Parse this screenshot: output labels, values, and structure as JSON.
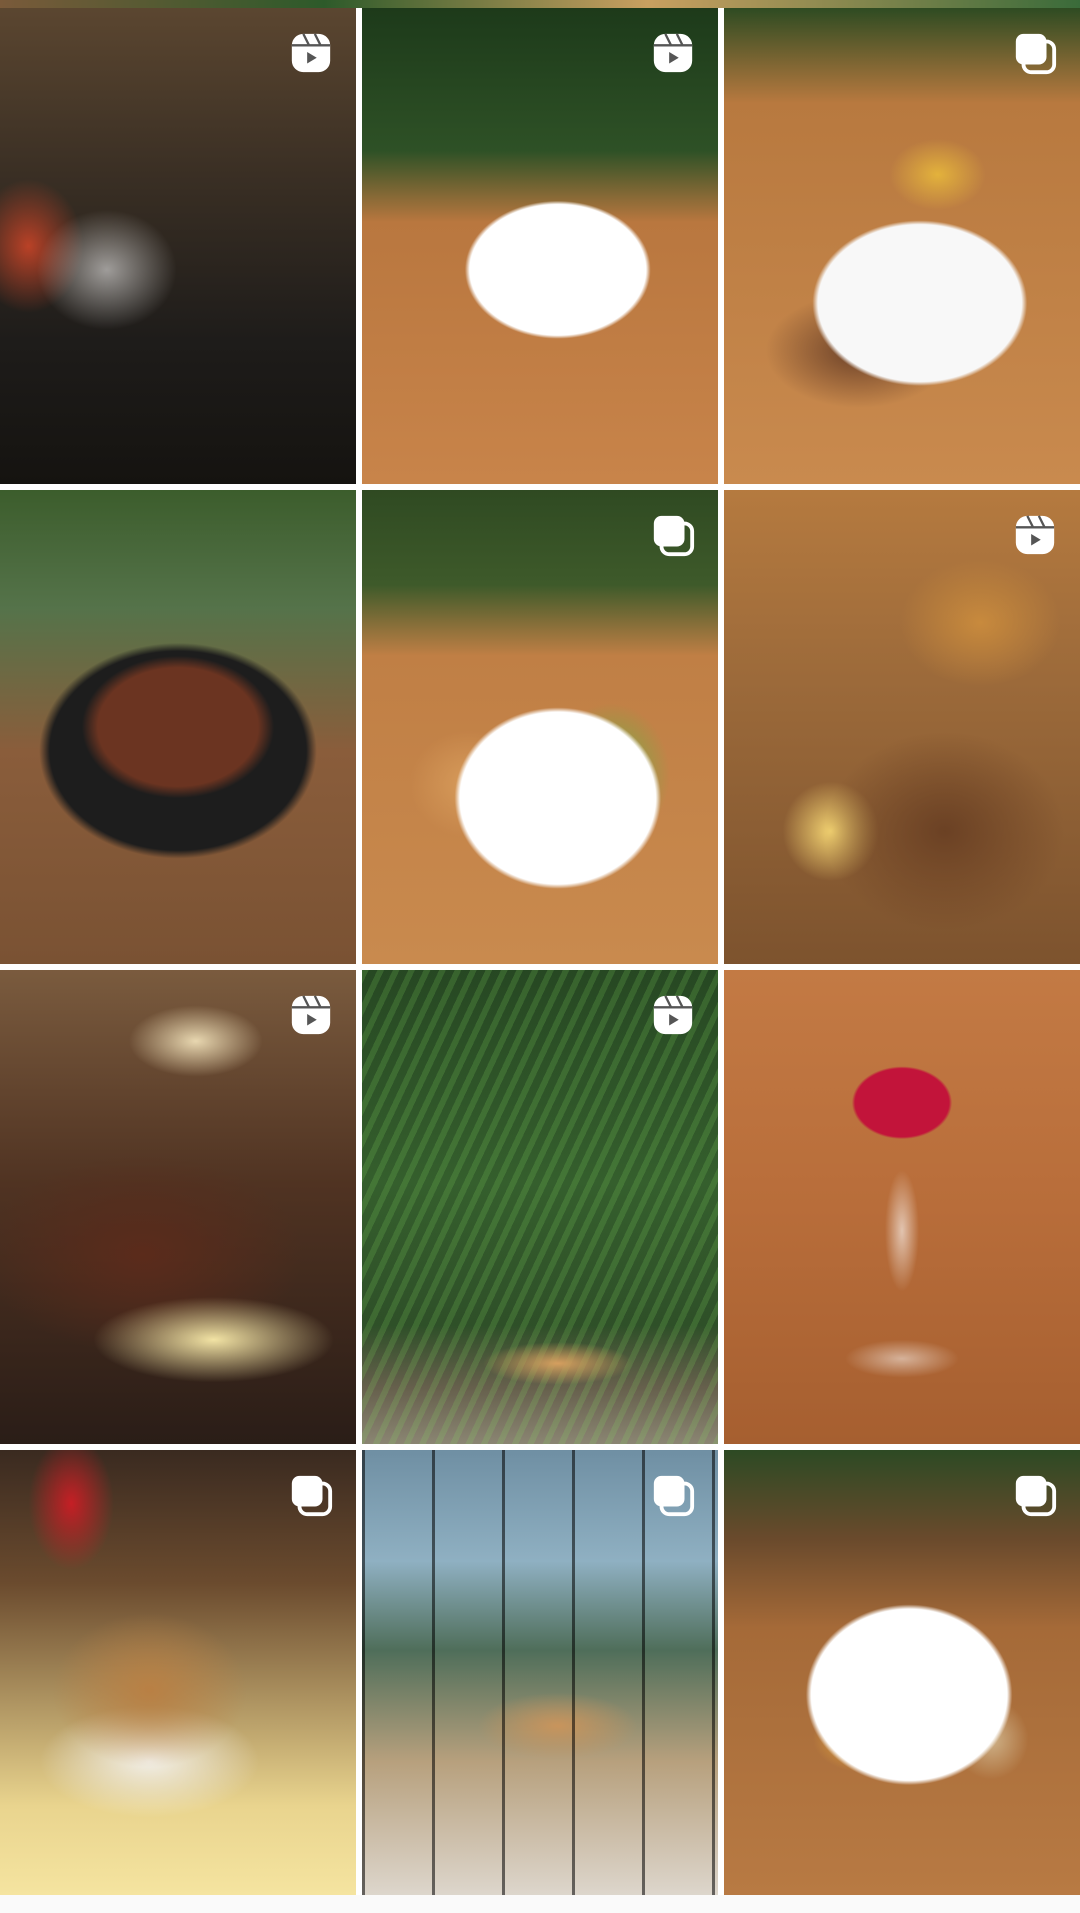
{
  "grid": {
    "posts": [
      {
        "name": "post-caipirinha-drinks",
        "badge": "reel-icon",
        "pinned": true
      },
      {
        "name": "post-steak-medallions",
        "badge": "reel-icon",
        "pinned": true
      },
      {
        "name": "post-steak-fries-rice",
        "badge": "carousel-icon",
        "pinned": true
      },
      {
        "name": "post-picanha-skillet",
        "badge": "none",
        "pinned": false
      },
      {
        "name": "post-grilled-chicken-salad",
        "badge": "carousel-icon",
        "pinned": false
      },
      {
        "name": "post-fried-platter",
        "badge": "reel-icon",
        "pinned": false
      },
      {
        "name": "post-ribeye-banana",
        "badge": "reel-icon",
        "pinned": false
      },
      {
        "name": "post-green-wall-dining",
        "badge": "reel-icon",
        "pinned": false
      },
      {
        "name": "post-red-cocktail",
        "badge": "none",
        "pinned": false
      },
      {
        "name": "post-burger-fries",
        "badge": "carousel-icon",
        "pinned": false
      },
      {
        "name": "post-glass-roof-dining",
        "badge": "carousel-icon",
        "pinned": false
      },
      {
        "name": "post-rice-farofa-dish",
        "badge": "carousel-icon",
        "pinned": false
      }
    ]
  },
  "colors": {
    "background": "#ffffff",
    "badge_fill": "#ffffff"
  }
}
